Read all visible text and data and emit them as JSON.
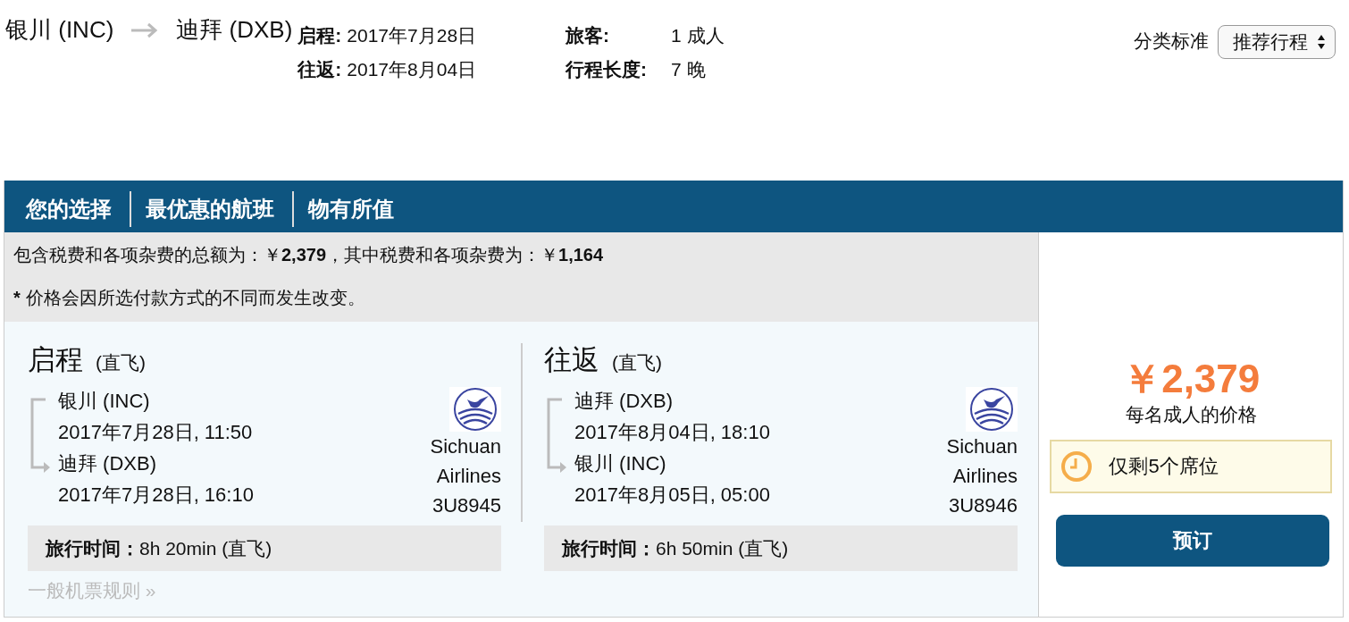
{
  "route": {
    "origin": "银川 (INC)",
    "destination": "迪拜 (DXB)"
  },
  "trip_info": [
    {
      "label": "启程:",
      "value": "2017年7月28日"
    },
    {
      "label": "旅客:",
      "value": "1 成人"
    },
    {
      "label": "往返:",
      "value": "2017年8月04日"
    },
    {
      "label": "行程长度:",
      "value": "7 晚"
    }
  ],
  "sort": {
    "label": "分类标准",
    "value": "推荐行程"
  },
  "tabs": [
    {
      "label": "您的选择"
    },
    {
      "label": "最优惠的航班"
    },
    {
      "label": "物有所值"
    }
  ],
  "summary": "包含税费和各项杂费的总额为：￥**2,379**，其中税费和各项杂费为：￥**1,164**",
  "note": {
    "mark": "*",
    "text": "价格会因所选付款方式的不同而发生改变。"
  },
  "legs": [
    {
      "title": "启程",
      "subtitle": "(直飞)",
      "from": {
        "place": "银川 (INC)",
        "time": "2017年7月28日, 11:50"
      },
      "to": {
        "place": "迪拜 (DXB)",
        "time": "2017年7月28日, 16:10"
      },
      "airline": [
        "Sichuan",
        "Airlines"
      ],
      "flight": "3U8945",
      "duration": "**旅行时间：**8h 20min (直飞)",
      "rules_link": "一般机票规则 »"
    },
    {
      "title": "往返",
      "subtitle": "(直飞)",
      "from": {
        "place": "迪拜 (DXB)",
        "time": "2017年8月04日, 18:10"
      },
      "to": {
        "place": "银川 (INC)",
        "time": "2017年8月05日, 05:00"
      },
      "airline": [
        "Sichuan",
        "Airlines"
      ],
      "flight": "3U8946",
      "duration": "**旅行时间：**6h 50min (直飞)"
    }
  ],
  "price": {
    "amount": "￥2,379",
    "caption": "每名成人的价格"
  },
  "seats_notice": "仅剩5个席位",
  "book_button": "预订"
}
